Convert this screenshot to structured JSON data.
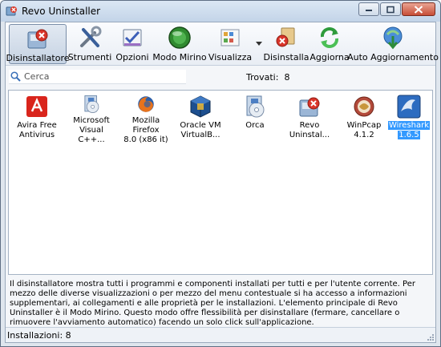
{
  "window": {
    "title": "Revo Uninstaller"
  },
  "toolbar": [
    {
      "label": "Disinstallatore",
      "icon": "uninstaller-icon",
      "active": true
    },
    {
      "label": "Strumenti",
      "icon": "tools-icon"
    },
    {
      "label": "Opzioni",
      "icon": "options-icon"
    },
    {
      "label": "Modo Mirino",
      "icon": "hunter-mode-icon"
    },
    {
      "label": "Visualizza",
      "icon": "view-icon"
    },
    {
      "label": "Disinstalla",
      "icon": "uninstall-icon"
    },
    {
      "label": "Aggiorna",
      "icon": "refresh-icon"
    },
    {
      "label": "Auto Aggiornamento",
      "icon": "auto-update-icon"
    }
  ],
  "search": {
    "placeholder": "Cerca",
    "found_label": "Trovati:",
    "found_count": "8"
  },
  "programs": [
    {
      "line1": "Avira Free",
      "line2": "Antivirus",
      "icon": "avira-icon"
    },
    {
      "line1": "Microsoft",
      "line2": "Visual C++...",
      "icon": "installer-disc-icon"
    },
    {
      "line1": "Mozilla Firefox",
      "line2": "8.0 (x86 it)",
      "icon": "firefox-icon"
    },
    {
      "line1": "Oracle VM",
      "line2": "VirtualB...",
      "icon": "virtualbox-icon"
    },
    {
      "line1": "Orca",
      "line2": "",
      "icon": "installer-disc-icon"
    },
    {
      "line1": "Revo",
      "line2": "Uninstal...",
      "icon": "uninstaller-icon"
    },
    {
      "line1": "WinPcap 4.1.2",
      "line2": "",
      "icon": "winpcap-icon"
    },
    {
      "line1": "Wireshark",
      "line2": "1.6.5",
      "icon": "wireshark-icon",
      "selected": true
    }
  ],
  "description": "Il disinstallatore mostra tutti i programmi e componenti installati per tutti e per l'utente corrente. Per mezzo delle diverse visualizzazioni o per mezzo del menu contestuale si ha accesso a informazioni supplementari, ai collegamenti e alle proprietà per le installazioni. L'elemento principale di Revo Uninstaller è il Modo Mirino. Questo modo offre flessibilità per disinstallare (fermare, cancellare o rimuovere l'avviamento automatico) facendo un solo click sull'applicazione.",
  "status": {
    "installations_label": "Installazioni: 8"
  },
  "colors": {
    "selection": "#3399ff",
    "titlebar": "#c3d4e8",
    "close": "#c74e37"
  }
}
